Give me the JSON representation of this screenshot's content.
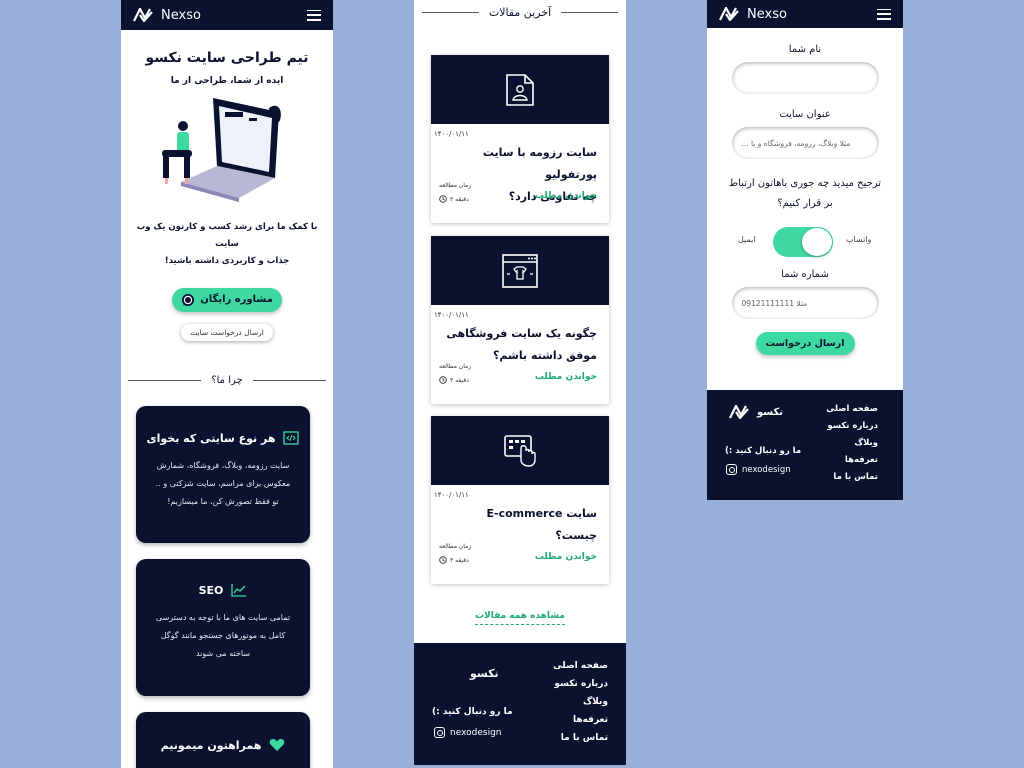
{
  "colors": {
    "navy": "#0b1230",
    "mint": "#3dd9a1",
    "green_text": "#1faa72",
    "background": "#98b0d9"
  },
  "brand": {
    "name": "Nexso",
    "logo_icon": "nexso-logo-icon"
  },
  "screen1": {
    "hero_title": "تیم طراحی سایت  نکسو",
    "hero_subtitle": "ایده از شما، طراحی از ما",
    "hero_desc_line1": "با کمک ما برای رشد کسب و کارتون یک وب سایت",
    "hero_desc_line2": "جذاب و کاربردی داشته باشید!",
    "cta_primary": "مشاوره رایگان",
    "cta_primary_icon": "whatsapp-icon",
    "cta_secondary": "ارسال درخواست سایت",
    "why_title": "چرا ما؟",
    "features": [
      {
        "title": "هر نوع سایتی که بخوای",
        "icon": "code-icon",
        "desc_lines": [
          "سایت رزومه، وبلاگ، فروشگاه، شمارش",
          "معکوس برای مراسم، سایت شرکتی و ..",
          "تو فقط تصورش کن، ما میسازیم!"
        ]
      },
      {
        "title": "SEO",
        "icon": "chart-line-icon",
        "desc_lines": [
          "تمامی سایت های ما با توجه به دسترسی",
          "کامل به موتورهای جستجو مانند گوگل",
          "ساخته می شوند"
        ]
      },
      {
        "title": "همراهتون میمونیم",
        "icon": "heart-icon"
      }
    ]
  },
  "screen2": {
    "section_title": "آخرین مقالات",
    "articles": [
      {
        "date": "۱۴۰۰/۰۱/۱۱",
        "title_lines": [
          "سایت رزومه با سایت پورتفولیو",
          "چه تفاوتی دارد؟"
        ],
        "reading_label": "زمان مطالعه",
        "reading_time": "۳ دقیقه",
        "read_more": "خواندن مطلب",
        "icon": "resume-file-icon"
      },
      {
        "date": "۱۴۰۰/۰۱/۱۱",
        "title_lines": [
          "چگونه یک سایت فروشگاهی",
          "موفق داشته باشم؟"
        ],
        "reading_label": "زمان مطالعه",
        "reading_time": "۳ دقیقه",
        "read_more": "خواندن مطلب",
        "icon": "shop-browser-icon"
      },
      {
        "date": "۱۴۰۰/۰۱/۱۱",
        "title_lines": [
          "سایت E-commerce چیست؟"
        ],
        "reading_label": "زمان مطالعه",
        "reading_time": "۳ دقیقه",
        "read_more": "خواندن مطلب",
        "icon": "ecommerce-touch-icon"
      }
    ],
    "view_all": "مشاهده همه مقالات"
  },
  "screen3": {
    "name_label": "نام شما",
    "site_title_label": "عنوان سایت",
    "site_title_placeholder": "مثلا وبلاگ، رزومه، فروشگاه و یا ...",
    "contact_q_line1": "ترجیح میدید چه جوری باهاتون ارتباط",
    "contact_q_line2": "بر قرار کنیم؟",
    "toggle_left": "ایمیل",
    "toggle_right": "واتساپ",
    "phone_label": "شماره شما",
    "phone_placeholder": "مثلا 09121111111",
    "submit": "ارسال درخواست"
  },
  "footer": {
    "menu": [
      "صفحه اصلی",
      "درباره نکسو",
      "وبلاگ",
      "تعرفه‌ها",
      "تماس با ما"
    ],
    "brand_fa": "نکسو",
    "follow": "ما رو دنبال کنید :)",
    "instagram": "nexodesign"
  }
}
